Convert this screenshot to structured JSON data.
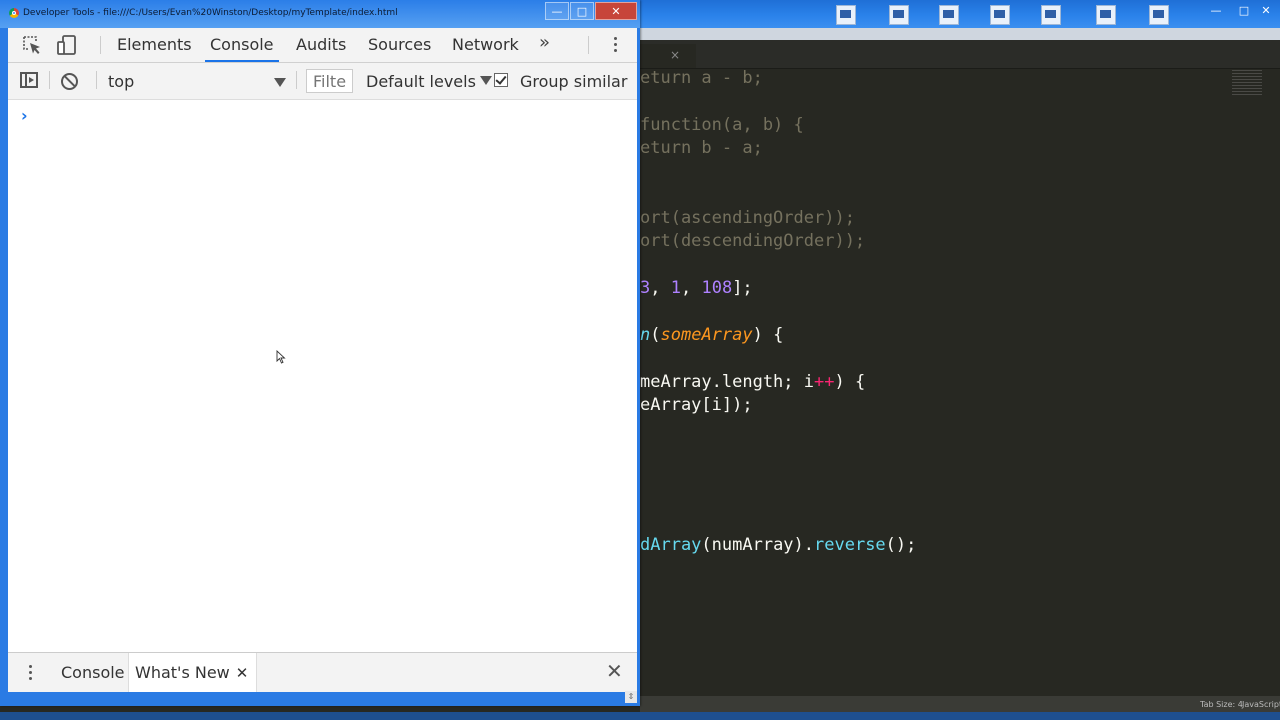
{
  "window": {
    "title": "Developer Tools - file:///C:/Users/Evan%20Winston/Desktop/myTemplate/index.html",
    "min_label": "—",
    "max_label": "□",
    "close_label": "✕"
  },
  "toolbar": {
    "tabs": [
      "Elements",
      "Console",
      "Audits",
      "Sources",
      "Network"
    ],
    "active_tab": "Console",
    "more_label": "»"
  },
  "console_toolbar": {
    "context": "top",
    "filter_placeholder": "Filter",
    "levels": "Default levels",
    "group_similar": "Group similar",
    "group_similar_checked": true
  },
  "console": {
    "prompt": "›"
  },
  "drawer": {
    "tabs": [
      "Console",
      "What's New"
    ],
    "active_tab": "What's New",
    "tab_close": "✕",
    "close_label": "✕"
  },
  "editor": {
    "tab_close": "×",
    "lines": [
      {
        "pre": "eturn a - b;"
      },
      {
        "pre": "function(a, b) {"
      },
      {
        "pre": "eturn b - a;"
      },
      {
        "pre": "ort(ascendingOrder));"
      },
      {
        "pre": "ort(descendingOrder));"
      },
      {
        "n1": "3",
        "sep": ", ",
        "n2": "1",
        "sep2": ", ",
        "n3": "108",
        "tail": "];"
      },
      {
        "fn": "n",
        "paren": "(",
        "param": "someArray",
        "tail": ") {"
      },
      {
        "a": "meArray.length; i",
        "op": "++",
        "b": ") {"
      },
      {
        "a": "eArray[i]);"
      },
      {
        "meth1": "dArray",
        "mid": "(numArray).",
        "meth2": "reverse",
        "tail": "();"
      }
    ],
    "status": {
      "tab_size": "Tab Size: 4",
      "syntax": "JavaScript"
    }
  },
  "colors": {
    "accent": "#1a73e8",
    "titlebar": "#2a7be4",
    "editor_bg": "#272822"
  }
}
